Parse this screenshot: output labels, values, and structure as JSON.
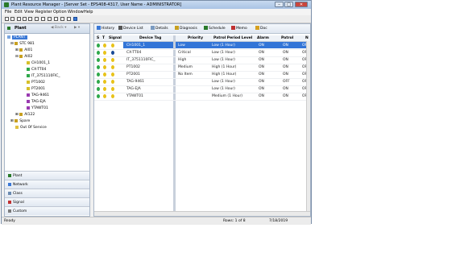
{
  "window": {
    "title": "Plant Resource Manager - [Server Set - EPS408-4317, User Name - ADMINISTRATOR]",
    "controls": {
      "minimize": "–",
      "maximize": "□",
      "close": "✕"
    }
  },
  "menu": [
    "File",
    "Edit",
    "View",
    "Register",
    "Option",
    "Window",
    "Help"
  ],
  "left_panel": {
    "title": "Plant",
    "back_label": "Back",
    "forward_label": "",
    "tree": [
      {
        "label": "PLANT",
        "level": 0,
        "selected": true
      },
      {
        "label": "STC 981",
        "level": 1
      },
      {
        "label": "AI01",
        "level": 2
      },
      {
        "label": "AI02",
        "level": 2
      },
      {
        "label": "CH1001_1",
        "level": 3
      },
      {
        "label": "CX-TT04",
        "level": 3
      },
      {
        "label": "IT_3751110FIC_",
        "level": 3
      },
      {
        "label": "PT1002",
        "level": 3
      },
      {
        "label": "PT2001",
        "level": 3
      },
      {
        "label": "TAG-9461",
        "level": 3
      },
      {
        "label": "TAG-EJA",
        "level": 3
      },
      {
        "label": "YTAWT01",
        "level": 3
      },
      {
        "label": "AI122",
        "level": 2
      },
      {
        "label": "Spare",
        "level": 1
      },
      {
        "label": "Out Of Service",
        "level": 1
      }
    ],
    "nav_tabs": [
      "Plant",
      "Network",
      "Class",
      "Signal",
      "Custom"
    ]
  },
  "right_panel": {
    "tabs": [
      "History",
      "Device List",
      "Details",
      "Diagnosis",
      "Schedule",
      "Memo",
      "Doc"
    ],
    "columns": [
      "S",
      "T",
      "Signal",
      "Device Tag",
      "Priority",
      "Patrol Period Level",
      "Alarm",
      "Patrol",
      "N"
    ],
    "rows": [
      {
        "tag": "CH1001_1",
        "priority": "Low",
        "patrol_level": "Low (1 Hour)",
        "alarm": "ON",
        "patrol": "ON",
        "n": "OFF",
        "status": "#2ea84a",
        "selected": true
      },
      {
        "tag": "CX-TT04",
        "priority": "Critical",
        "patrol_level": "Low (1 Hour)",
        "alarm": "ON",
        "patrol": "ON",
        "n": "OFF",
        "status": "#2ea84a"
      },
      {
        "tag": "IT_3751110FIC_",
        "priority": "High",
        "patrol_level": "Low (1 Hour)",
        "alarm": "ON",
        "patrol": "ON",
        "n": "OFF",
        "status": "#2ea84a"
      },
      {
        "tag": "PT1002",
        "priority": "Medium",
        "patrol_level": "High (1 Hour)",
        "alarm": "ON",
        "patrol": "ON",
        "n": "OFF",
        "status": "#2ea84a"
      },
      {
        "tag": "PT2001",
        "priority": "No Item",
        "patrol_level": "High (1 Hour)",
        "alarm": "ON",
        "patrol": "ON",
        "n": "OFF",
        "status": "#2ea84a"
      },
      {
        "tag": "TAG-9461",
        "priority": "",
        "patrol_level": "Low (1 Hour)",
        "alarm": "ON",
        "patrol": "OFF",
        "n": "OFF",
        "status": "#2ea84a"
      },
      {
        "tag": "TAG-EJA",
        "priority": "",
        "patrol_level": "Low (1 Hour)",
        "alarm": "ON",
        "patrol": "ON",
        "n": "OFF",
        "status": "#2ea84a"
      },
      {
        "tag": "YTAWT01",
        "priority": "",
        "patrol_level": "Medium (1 Hour)",
        "alarm": "ON",
        "patrol": "ON",
        "n": "OFF",
        "status": "#2ea84a"
      }
    ]
  },
  "status": {
    "left": "Ready",
    "middle": "Rows: 1 of 8",
    "right": "7/18/2019"
  },
  "colors": {
    "accent": "#3375d7",
    "status_ok": "#2ea84a",
    "signal_yellow": "#e8c21a"
  }
}
